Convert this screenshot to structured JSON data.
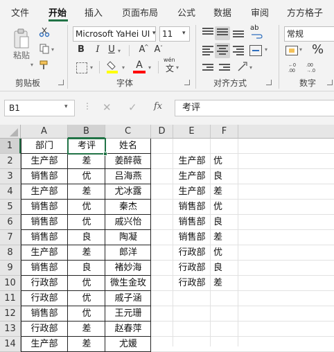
{
  "ribbon_tabs": [
    "文件",
    "开始",
    "插入",
    "页面布局",
    "公式",
    "数据",
    "审阅",
    "方方格子"
  ],
  "clipboard": {
    "paste": "粘贴",
    "group": "剪贴板"
  },
  "font": {
    "name": "Microsoft YaHei UI",
    "size": "11",
    "bold": "B",
    "italic": "I",
    "underline": "U",
    "grow": "A",
    "shrink": "A",
    "phonetic_top": "wén",
    "phonetic_bottom": "文",
    "group": "字体",
    "highlight_color": "#ffff00",
    "font_color": "#ff0000"
  },
  "alignment": {
    "wrap": "ab",
    "group": "对齐方式"
  },
  "number": {
    "format": "常规",
    "percent": "%",
    "group": "数字"
  },
  "formula_bar": {
    "name_box": "B1",
    "fx": "fx",
    "content": "考评"
  },
  "columns": [
    "A",
    "B",
    "C",
    "D",
    "E",
    "F"
  ],
  "rows": [
    "1",
    "2",
    "3",
    "4",
    "5",
    "6",
    "7",
    "8",
    "9",
    "10",
    "11",
    "12",
    "13",
    "14"
  ],
  "table_headers": [
    "部门",
    "考评",
    "姓名"
  ],
  "table_rows": [
    [
      "生产部",
      "差",
      "姜醉薇"
    ],
    [
      "销售部",
      "优",
      "吕海燕"
    ],
    [
      "生产部",
      "差",
      "尤冰露"
    ],
    [
      "销售部",
      "优",
      "秦杰"
    ],
    [
      "销售部",
      "优",
      "戚兴怡"
    ],
    [
      "销售部",
      "良",
      "陶凝"
    ],
    [
      "生产部",
      "差",
      "郎洋"
    ],
    [
      "销售部",
      "良",
      "褚妙海"
    ],
    [
      "行政部",
      "优",
      "微生金玫"
    ],
    [
      "行政部",
      "优",
      "戚子涵"
    ],
    [
      "销售部",
      "优",
      "王元珊"
    ],
    [
      "行政部",
      "差",
      "赵春萍"
    ],
    [
      "生产部",
      "差",
      "尤媛"
    ]
  ],
  "side_rows": [
    [
      "生产部",
      "优"
    ],
    [
      "生产部",
      "良"
    ],
    [
      "生产部",
      "差"
    ],
    [
      "销售部",
      "优"
    ],
    [
      "销售部",
      "良"
    ],
    [
      "销售部",
      "差"
    ],
    [
      "行政部",
      "优"
    ],
    [
      "行政部",
      "良"
    ],
    [
      "行政部",
      "差"
    ]
  ]
}
